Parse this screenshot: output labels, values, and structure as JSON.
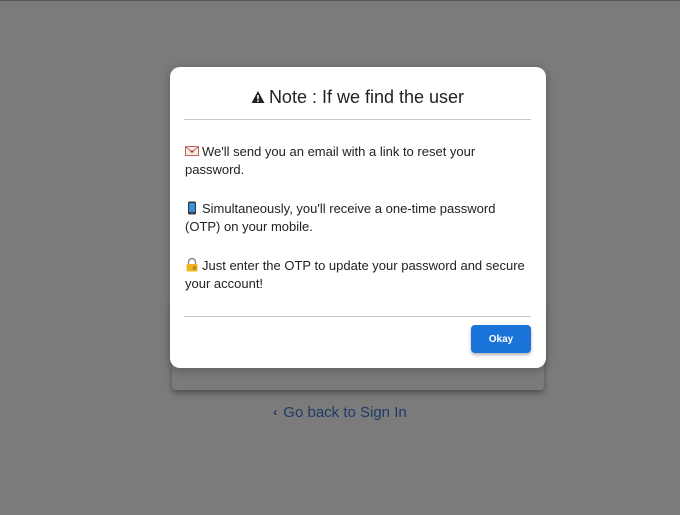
{
  "dialog": {
    "title": "Note : If we find the user",
    "title_icon": "warning-icon",
    "messages": [
      {
        "icon": "envelope-icon",
        "text": "We'll send you an email with a link to reset your password."
      },
      {
        "icon": "mobile-phone-icon",
        "text": "Simultaneously, you'll receive a one-time password (OTP) on your mobile."
      },
      {
        "icon": "lock-key-icon",
        "text": "Just enter the OTP to update your password and secure your account!"
      }
    ],
    "okay_label": "Okay"
  },
  "background": {
    "back_link": "Go back to Sign In"
  },
  "colors": {
    "overlay": "#7b7b7b",
    "primary": "#1a73d9",
    "link": "#1d3c66"
  }
}
